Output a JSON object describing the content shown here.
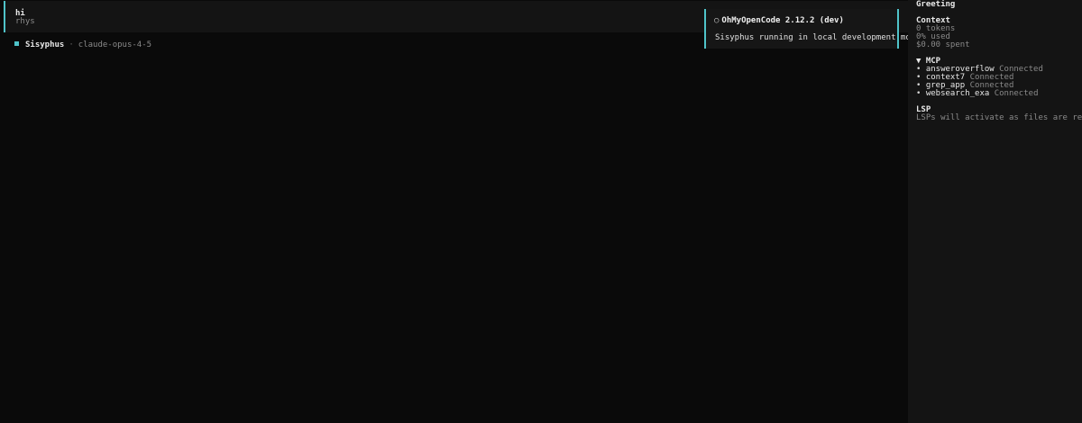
{
  "message": {
    "text": "hi",
    "user": "rhys"
  },
  "agent": {
    "name": "Sisyphus",
    "separator": "·",
    "model": "claude-opus-4-5"
  },
  "toast": {
    "icon": "circle-icon",
    "title": "OhMyOpenCode 2.12.2 (dev)",
    "body": "Sisyphus running in local development mode."
  },
  "sidebar": {
    "title": "Greeting",
    "context": {
      "heading": "Context",
      "tokens": "0 tokens",
      "used": "0% used",
      "spent": "$0.00 spent"
    },
    "mcp": {
      "heading": "▼ MCP",
      "items": [
        {
          "bullet": "•",
          "name": "answeroverflow",
          "status": "Connected"
        },
        {
          "bullet": "•",
          "name": "context7",
          "status": "Connected"
        },
        {
          "bullet": "•",
          "name": "grep_app",
          "status": "Connected"
        },
        {
          "bullet": "•",
          "name": "websearch_exa",
          "status": "Connected"
        }
      ]
    },
    "lsp": {
      "heading": "LSP",
      "note": "LSPs will activate as files are read"
    }
  },
  "colors": {
    "accent": "#4fc3c9",
    "background": "#0a0a0a",
    "panel": "#141414"
  }
}
